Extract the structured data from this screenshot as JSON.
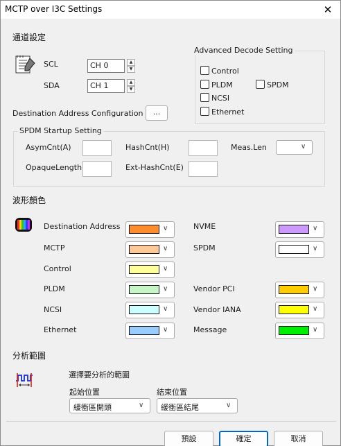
{
  "window": {
    "title": "MCTP over I3C Settings",
    "close_glyph": "✕"
  },
  "channel": {
    "heading": "通道設定",
    "scl_label": "SCL",
    "scl_value": "CH 0",
    "sda_label": "SDA",
    "sda_value": "CH 1"
  },
  "advanced": {
    "title": "Advanced Decode Setting",
    "control": "Control",
    "pldm": "PLDM",
    "spdm": "SPDM",
    "ncsi": "NCSI",
    "ethernet": "Ethernet"
  },
  "dest_config": {
    "label": "Destination Address Configuration",
    "button": "..."
  },
  "spdm_startup": {
    "title": "SPDM Startup Setting",
    "asym": "AsymCnt(A)",
    "hash": "HashCnt(H)",
    "meas": "Meas.Len",
    "opaque": "OpaqueLength",
    "exthash": "Ext-HashCnt(E)"
  },
  "colors": {
    "heading": "波形顏色",
    "items": [
      {
        "label": "Destination Address",
        "color": "#ff8c2a"
      },
      {
        "label": "MCTP",
        "color": "#ffc99a"
      },
      {
        "label": "Control",
        "color": "#ffff99"
      },
      {
        "label": "PLDM",
        "color": "#c8f5c8"
      },
      {
        "label": "NCSI",
        "color": "#ccffff"
      },
      {
        "label": "Ethernet",
        "color": "#99ccff"
      },
      {
        "label": "NVME",
        "color": "#cc99ff"
      },
      {
        "label": "SPDM",
        "color": "#ffffff"
      },
      {
        "label": "Vendor PCI",
        "color": "#ffcc00"
      },
      {
        "label": "Vendor IANA",
        "color": "#ffff00"
      },
      {
        "label": "Message",
        "color": "#00ee00"
      }
    ]
  },
  "range": {
    "heading": "分析範圍",
    "subheading": "選擇要分析的範圍",
    "start_label": "起始位置",
    "start_value": "緩衝區開頭",
    "end_label": "結束位置",
    "end_value": "緩衝區結尾"
  },
  "footer": {
    "default": "預設",
    "ok": "確定",
    "cancel": "取消"
  },
  "icons": {
    "settings_doc": "notepad-pencil-icon",
    "colors": "color-palette-icon",
    "range": "waveform-range-icon"
  }
}
